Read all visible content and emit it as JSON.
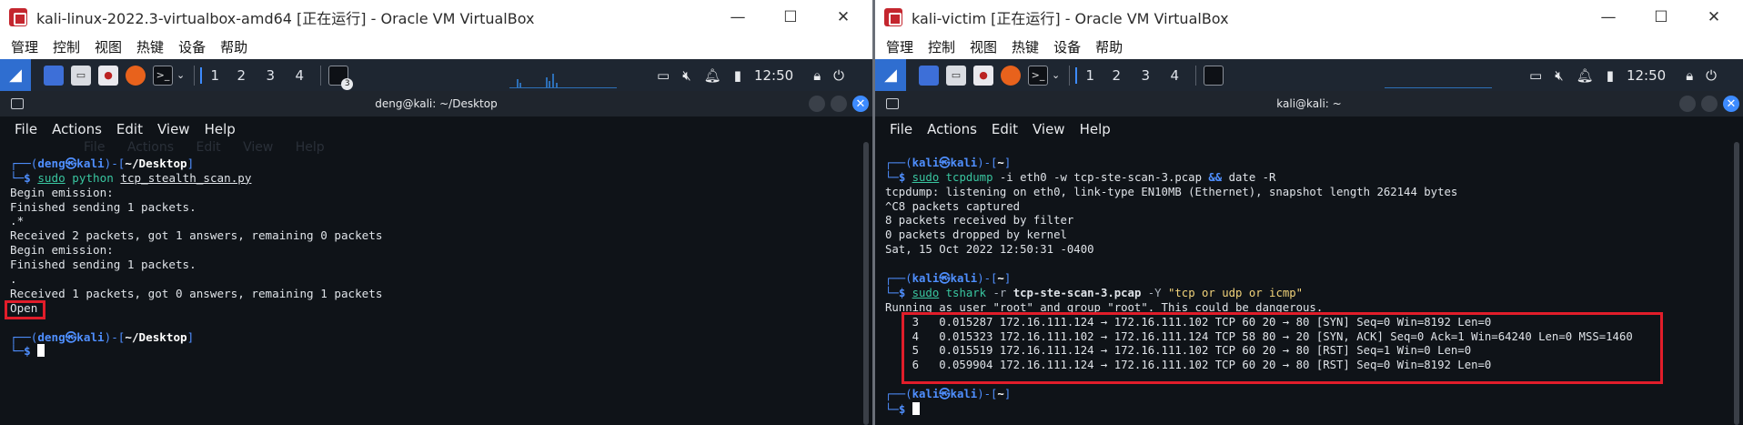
{
  "left_vm": {
    "window_title": "kali-linux-2022.3-virtualbox-amd64 [正在运行] - Oracle VM VirtualBox",
    "window_controls": {
      "minimize": "—",
      "maximize": "☐",
      "close": "✕"
    },
    "menu": [
      "管理",
      "控制",
      "视图",
      "热键",
      "设备",
      "帮助"
    ],
    "panel": {
      "workspaces": [
        "1",
        "2",
        "3",
        "4"
      ],
      "badge": "3",
      "clock": "12:50"
    },
    "terminal": {
      "title": "deng@kali: ~/Desktop",
      "menu": [
        "File",
        "Actions",
        "Edit",
        "View",
        "Help"
      ],
      "ghost_menu": [
        "File",
        "Actions",
        "Edit",
        "View",
        "Help"
      ],
      "prompt1": {
        "user": "deng",
        "host": "kali",
        "dir": "~/Desktop"
      },
      "command1": {
        "sudo": "sudo",
        "prog": "python",
        "arg": "tcp_stealth_scan.py"
      },
      "output": [
        "Begin emission:",
        "Finished sending 1 packets.",
        ".*",
        "Received 2 packets, got 1 answers, remaining 0 packets",
        "Begin emission:",
        "Finished sending 1 packets.",
        ".",
        "Received 1 packets, got 0 answers, remaining 1 packets"
      ],
      "result": "Open",
      "prompt2": {
        "user": "deng",
        "host": "kali",
        "dir": "~/Desktop"
      }
    }
  },
  "right_vm": {
    "window_title": "kali-victim [正在运行] - Oracle VM VirtualBox",
    "window_controls": {
      "minimize": "—",
      "maximize": "☐",
      "close": "✕"
    },
    "menu": [
      "管理",
      "控制",
      "视图",
      "热键",
      "设备",
      "帮助"
    ],
    "panel": {
      "workspaces": [
        "1",
        "2",
        "3",
        "4"
      ],
      "clock": "12:50"
    },
    "terminal": {
      "title": "kali@kali: ~",
      "menu": [
        "File",
        "Actions",
        "Edit",
        "View",
        "Help"
      ],
      "prompt1": {
        "user": "kali",
        "host": "kali",
        "dir": "~"
      },
      "command1": {
        "sudo": "sudo",
        "prog": "tcpdump",
        "args": "-i eth0 -w tcp-ste-scan-3.pcap",
        "amp": "&&",
        "tail": "date -R"
      },
      "output1": [
        "tcpdump: listening on eth0, link-type EN10MB (Ethernet), snapshot length 262144 bytes",
        "^C8 packets captured",
        "8 packets received by filter",
        "0 packets dropped by kernel",
        "Sat, 15 Oct 2022 12:50:31 -0400"
      ],
      "prompt2": {
        "user": "kali",
        "host": "kali",
        "dir": "~"
      },
      "command2": {
        "sudo": "sudo",
        "prog": "tshark",
        "flag_r": "-r",
        "file": "tcp-ste-scan-3.pcap",
        "flag_y": "-Y",
        "filter": "\"tcp or udp or icmp\""
      },
      "warning": "Running as user \"root\" and group \"root\". This could be dangerous.",
      "packets": [
        "    3   0.015287 172.16.111.124 → 172.16.111.102 TCP 60 20 → 80 [SYN] Seq=0 Win=8192 Len=0",
        "    4   0.015323 172.16.111.102 → 172.16.111.124 TCP 58 80 → 20 [SYN, ACK] Seq=0 Ack=1 Win=64240 Len=0 MSS=1460",
        "    5   0.015519 172.16.111.124 → 172.16.111.102 TCP 60 20 → 80 [RST] Seq=1 Win=0 Len=0",
        "    6   0.059904 172.16.111.124 → 172.16.111.102 TCP 60 20 → 80 [RST] Seq=0 Win=8192 Len=0"
      ],
      "prompt3": {
        "user": "kali",
        "host": "kali",
        "dir": "~"
      }
    }
  },
  "colors": {
    "highlight_box": "#e11d2a",
    "prompt_blue": "#4f8fff",
    "command_green": "#39c6a0",
    "panel_bg": "#1e2631",
    "terminal_bg": "#0f1318"
  }
}
